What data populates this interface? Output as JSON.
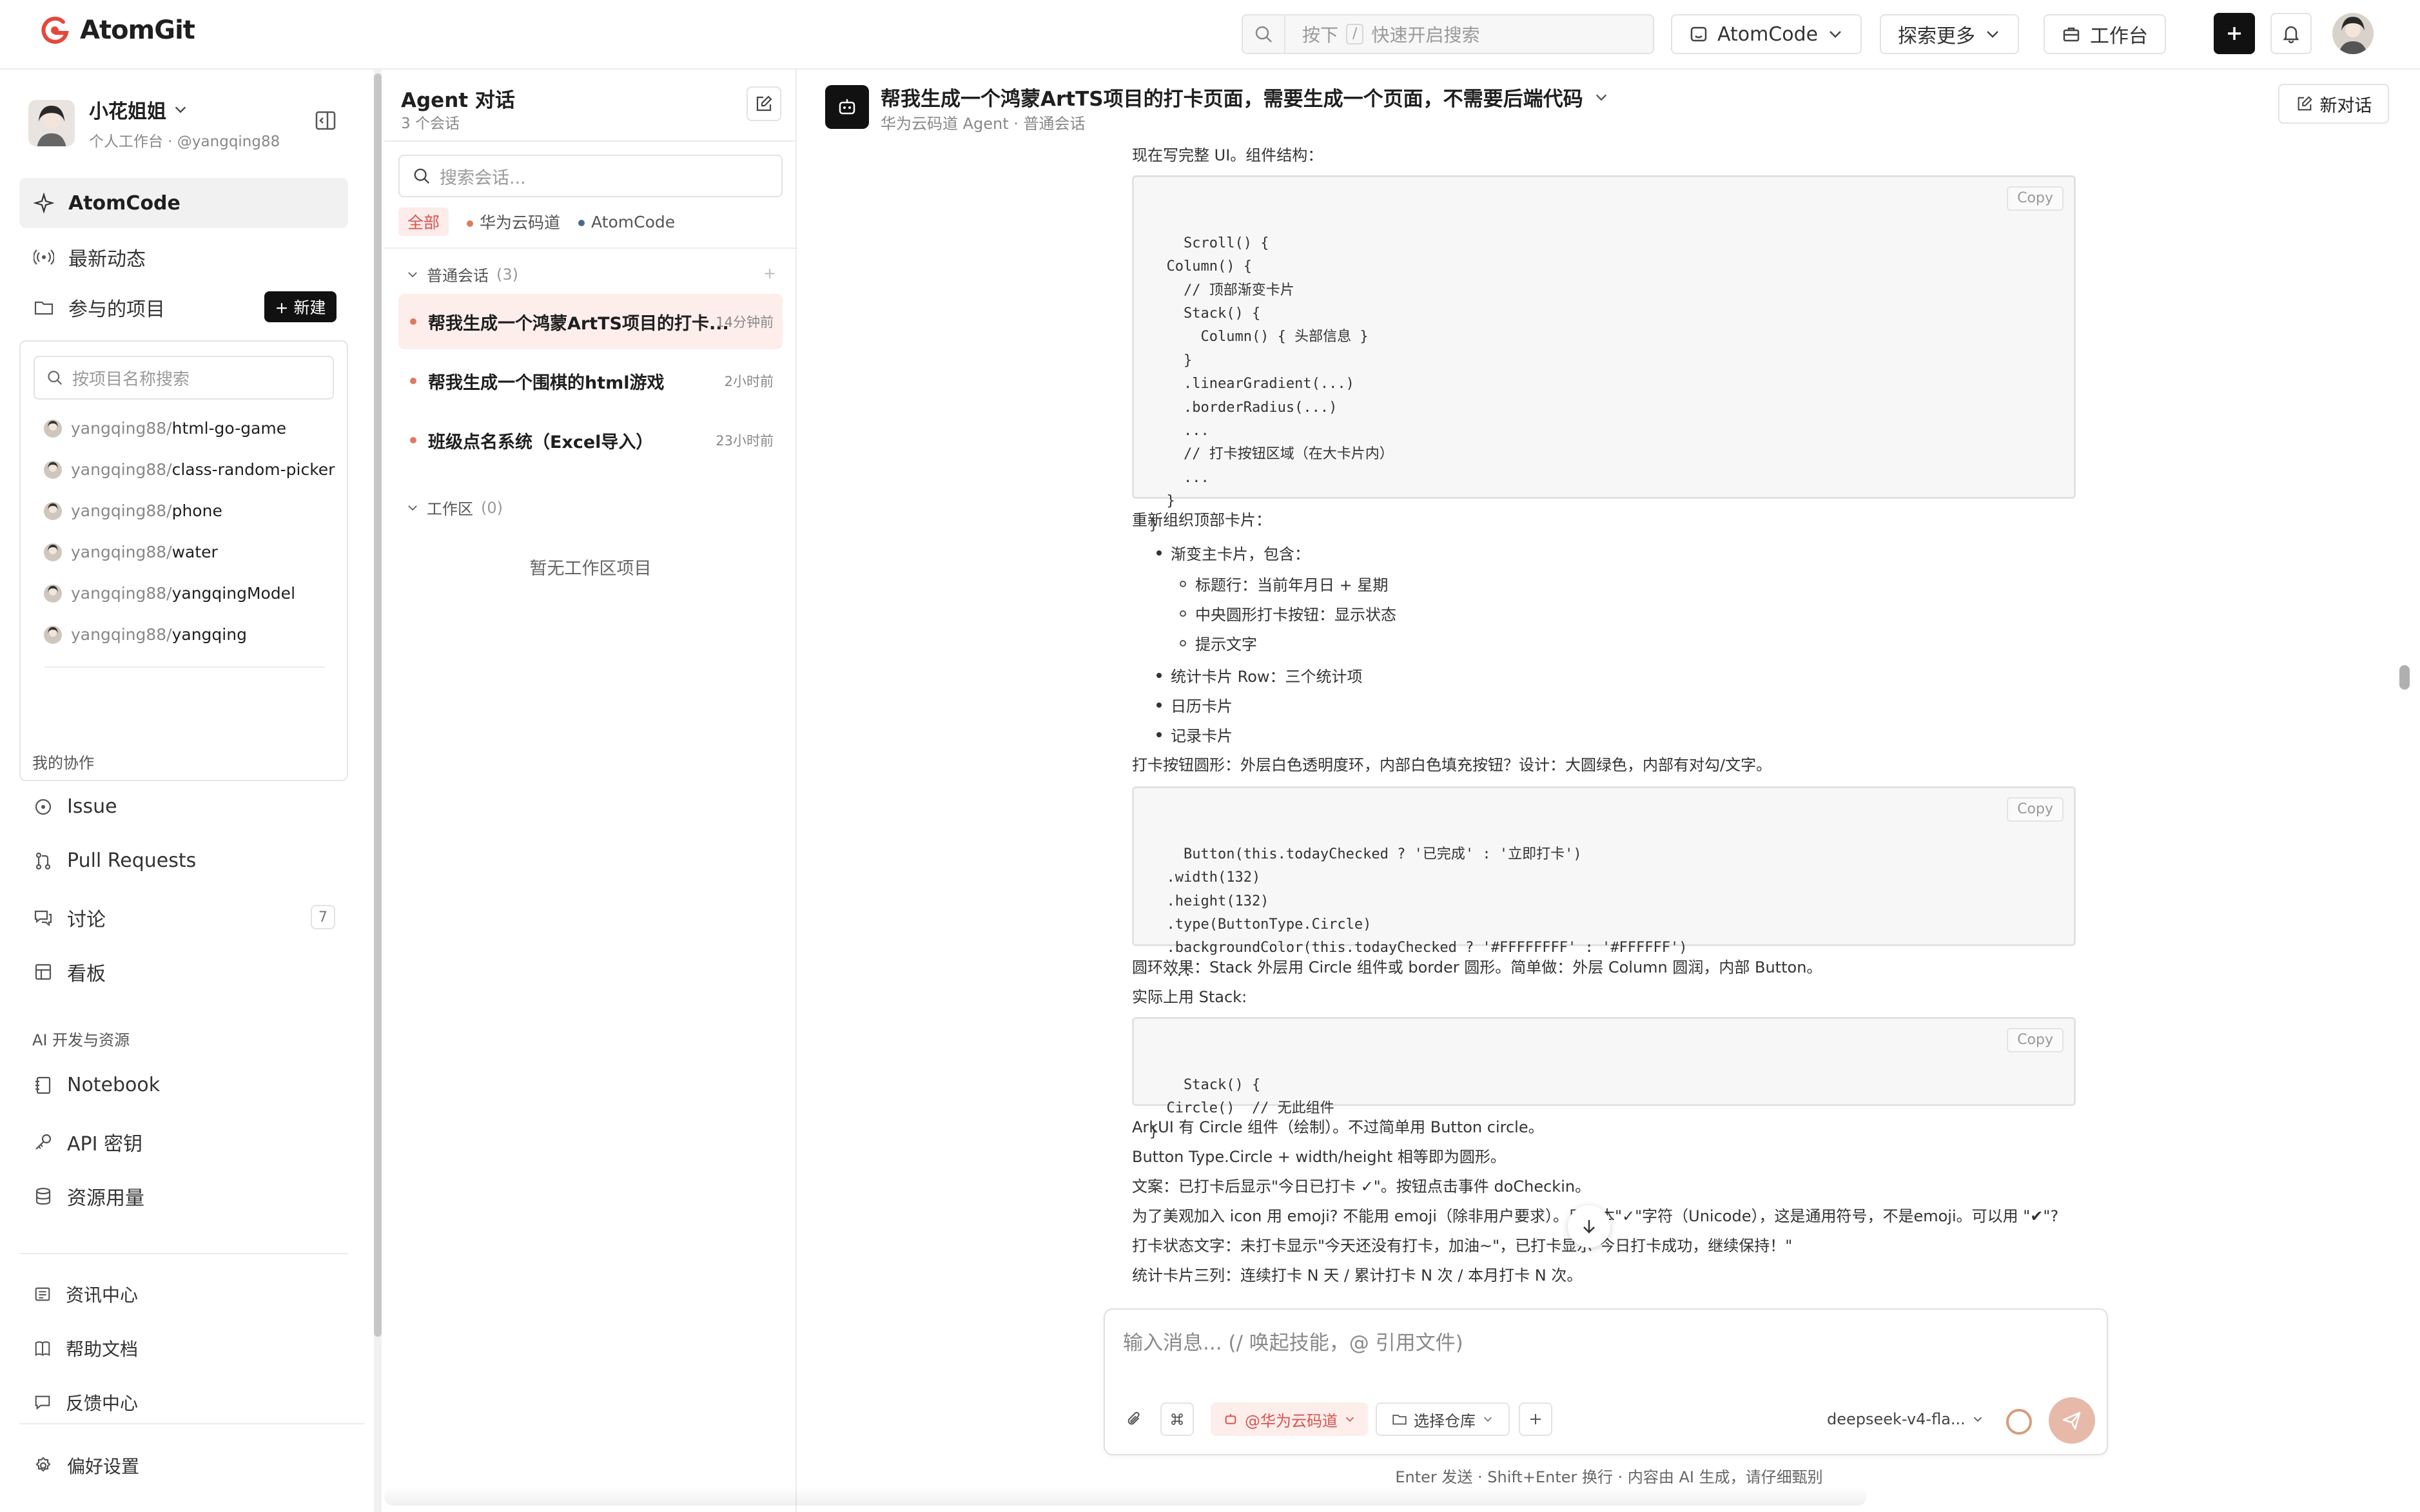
{
  "app": {
    "name": "AtomGit",
    "brand_color": "#e5483b"
  },
  "topbar": {
    "search_prefix": "按下",
    "search_key": "/",
    "search_placeholder": "快速开启搜索",
    "atomcode_label": "AtomCode",
    "explore_label": "探索更多",
    "workbench_label": "工作台"
  },
  "sidebar": {
    "user_name": "小花姐姐",
    "user_sub": "个人工作台 · @yangqing88",
    "nav_main": [
      "AtomCode",
      "最新动态",
      "参与的项目"
    ],
    "new_label": "+ 新建",
    "project_search_placeholder": "按项目名称搜索",
    "projects": [
      {
        "owner": "yangqing88/",
        "name": "html-go-game"
      },
      {
        "owner": "yangqing88/",
        "name": "class-random-picker"
      },
      {
        "owner": "yangqing88/",
        "name": "phone"
      },
      {
        "owner": "yangqing88/",
        "name": "water"
      },
      {
        "owner": "yangqing88/",
        "name": "yangqingModel"
      },
      {
        "owner": "yangqing88/",
        "name": "yangqing"
      }
    ],
    "collab_title": "我的协作",
    "collab_items": [
      "Issue",
      "Pull Requests",
      "讨论",
      "看板"
    ],
    "discuss_count": "7",
    "ai_title": "AI 开发与资源",
    "ai_items": [
      "Notebook",
      "API 密钥",
      "资源用量"
    ],
    "bottom_items": [
      "资讯中心",
      "帮助文档",
      "反馈中心"
    ],
    "settings_label": "偏好设置"
  },
  "agent": {
    "title": "Agent 对话",
    "count": "3 个会话",
    "search_placeholder": "搜索会话...",
    "filters": [
      "全部",
      "华为云码道",
      "AtomCode"
    ],
    "filter_colors": {
      "huawei": "#e07a5f",
      "atomcode": "#4a6a8a"
    },
    "group_normal": "普通会话",
    "group_normal_count": "(3)",
    "conversations": [
      {
        "title": "帮我生成一个鸿蒙ArtTS项目的打卡...",
        "time": "14分钟前"
      },
      {
        "title": "帮我生成一个围棋的html游戏",
        "time": "2小时前"
      },
      {
        "title": "班级点名系统（Excel导入）",
        "time": "23小时前"
      }
    ],
    "group_work": "工作区",
    "group_work_count": "(0)",
    "empty_text": "暂无工作区项目"
  },
  "chat": {
    "title": "帮我生成一个鸿蒙ArtTS项目的打卡页面，需要生成一个页面，不需要后端代码",
    "subtitle": "华为云码道 Agent · 普通会话",
    "new_label": "新对话",
    "copy_label": "Copy",
    "p1": "现在写完整 UI。组件结构：",
    "code1": "Scroll() {\n  Column() {\n    // 顶部渐变卡片\n    Stack() {\n      Column() { 头部信息 }\n    }\n    .linearGradient(...)\n    .borderRadius(...)\n    ...\n    // 打卡按钮区域（在大卡片内）\n    ...\n  }\n}",
    "p2": "重新组织顶部卡片：",
    "b1": "渐变主卡片，包含：",
    "b1_sub": [
      "标题行：当前年月日 + 星期",
      "中央圆形打卡按钮：显示状态",
      "提示文字"
    ],
    "b2": "统计卡片 Row：三个统计项",
    "b3": "日历卡片",
    "b4": "记录卡片",
    "p3": "打卡按钮圆形：外层白色透明度环，内部白色填充按钮？设计：大圆绿色，内部有对勾/文字。",
    "code2": "Button(this.todayChecked ? '已完成' : '立即打卡')\n  .width(132)\n  .height(132)\n  .type(ButtonType.Circle)\n  .backgroundColor(this.todayChecked ? '#FFFFFFFF' : '#FFFFFF')\n  ...",
    "p4": "圆环效果：Stack 外层用 Circle 组件或 border 圆形。简单做：外层 Column 圆润，内部 Button。",
    "p5": "实际上用 Stack:",
    "code3": "Stack() {\n  Circle()  // 无此组件\n}",
    "p6": "ArkUI 有 Circle 组件（绘制）。不过简单用 Button circle。",
    "p7": "Button Type.Circle + width/height 相等即为圆形。",
    "p8": "文案：已打卡后显示\"今日已打卡 ✓\"。按钮点击事件 doCheckin。",
    "p9": "为了美观加入 icon 用 emoji? 不能用 emoji（除非用户要求）。用文本\"✓\"字符（Unicode），这是通用符号，不是emoji。可以用 \"✔\"?",
    "p10": "打卡状态文字：未打卡显示\"今天还没有打卡，加油~\"，已打卡显示\"今日打卡成功，继续保持！\"",
    "p11": "统计卡片三列：连续打卡 N 天 / 累计打卡 N 次 / 本月打卡 N 次。",
    "composer_placeholder": "输入消息...  (/ 唤起技能，@ 引用文件)",
    "channel_label": "@华为云码道",
    "repo_label": "选择仓库",
    "model_label": "deepseek-v4-fla...",
    "footer": "Enter 发送 · Shift+Enter 换行 · 内容由 AI 生成，请仔细甄别"
  }
}
